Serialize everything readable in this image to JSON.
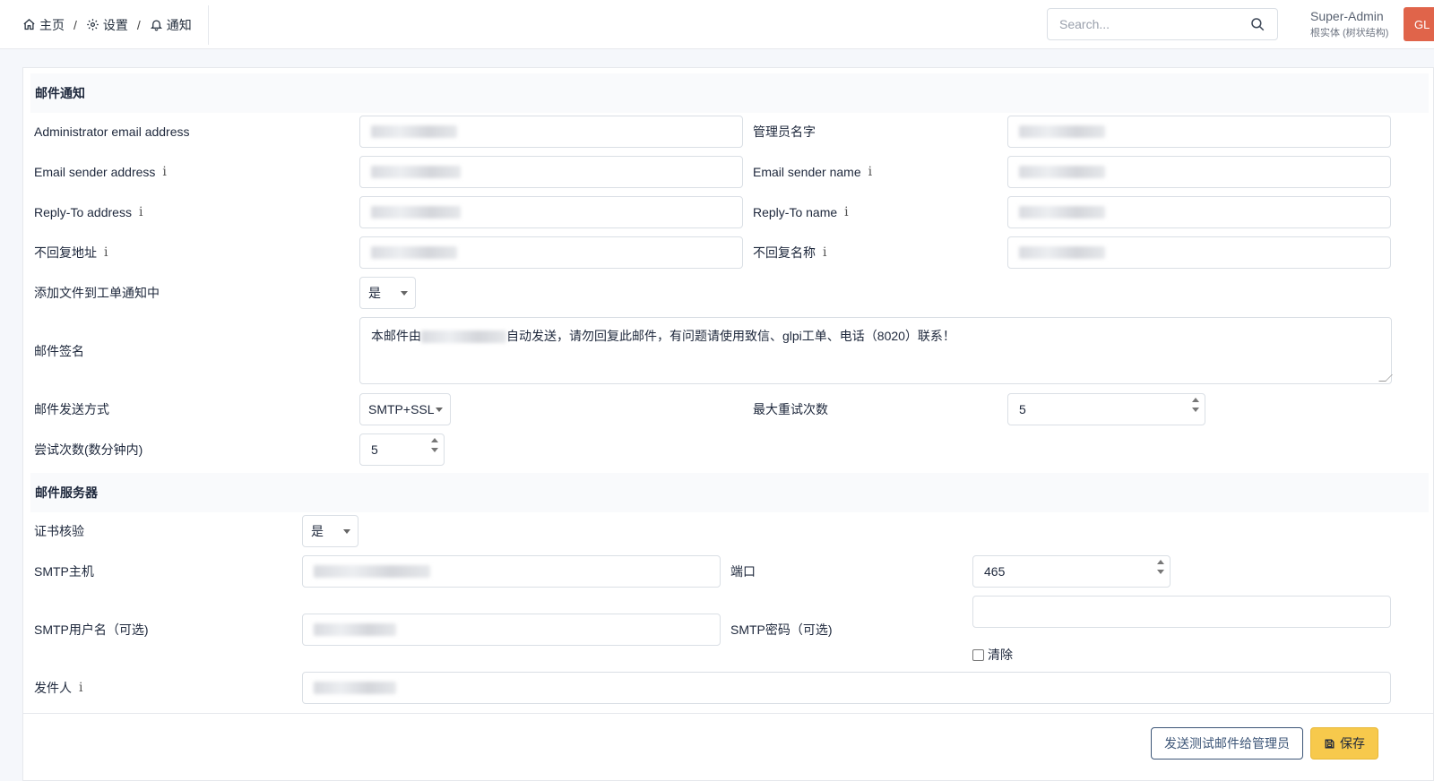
{
  "breadcrumb": {
    "home": "主页",
    "settings": "设置",
    "notifications": "通知",
    "separator": "/"
  },
  "search": {
    "placeholder": "Search..."
  },
  "user": {
    "name": "Super-Admin",
    "entity": "根实体 (树状结构)",
    "initials": "GL"
  },
  "email_section": {
    "title": "邮件通知",
    "admin_email_label": "Administrator email address",
    "admin_name_label": "管理员名字",
    "sender_address_label": "Email sender address",
    "sender_name_label": "Email sender name",
    "reply_to_address_label": "Reply-To address",
    "reply_to_name_label": "Reply-To name",
    "noreply_address_label": "不回复地址",
    "noreply_name_label": "不回复名称",
    "attach_label": "添加文件到工单通知中",
    "attach_value": "是",
    "signature_label": "邮件签名",
    "signature_prefix": "本邮件由",
    "signature_suffix": "自动发送，请勿回复此邮件，有问题请使用致信、glpi工单、电话（8020）联系！",
    "method_label": "邮件发送方式",
    "method_value": "SMTP+SSL",
    "max_retry_label": "最大重试次数",
    "max_retry_value": "5",
    "retry_interval_label": "尝试次数(数分钟内)",
    "retry_interval_value": "5"
  },
  "server_section": {
    "title": "邮件服务器",
    "cert_label": "证书核验",
    "cert_value": "是",
    "smtp_host_label": "SMTP主机",
    "port_label": "端口",
    "port_value": "465",
    "smtp_user_label": "SMTP用户名（可选)",
    "smtp_password_label": "SMTP密码（可选)",
    "clear_label": "清除",
    "from_label": "发件人"
  },
  "info_glyph": "i",
  "buttons": {
    "test": "发送测试邮件给管理员",
    "save": "保存"
  }
}
